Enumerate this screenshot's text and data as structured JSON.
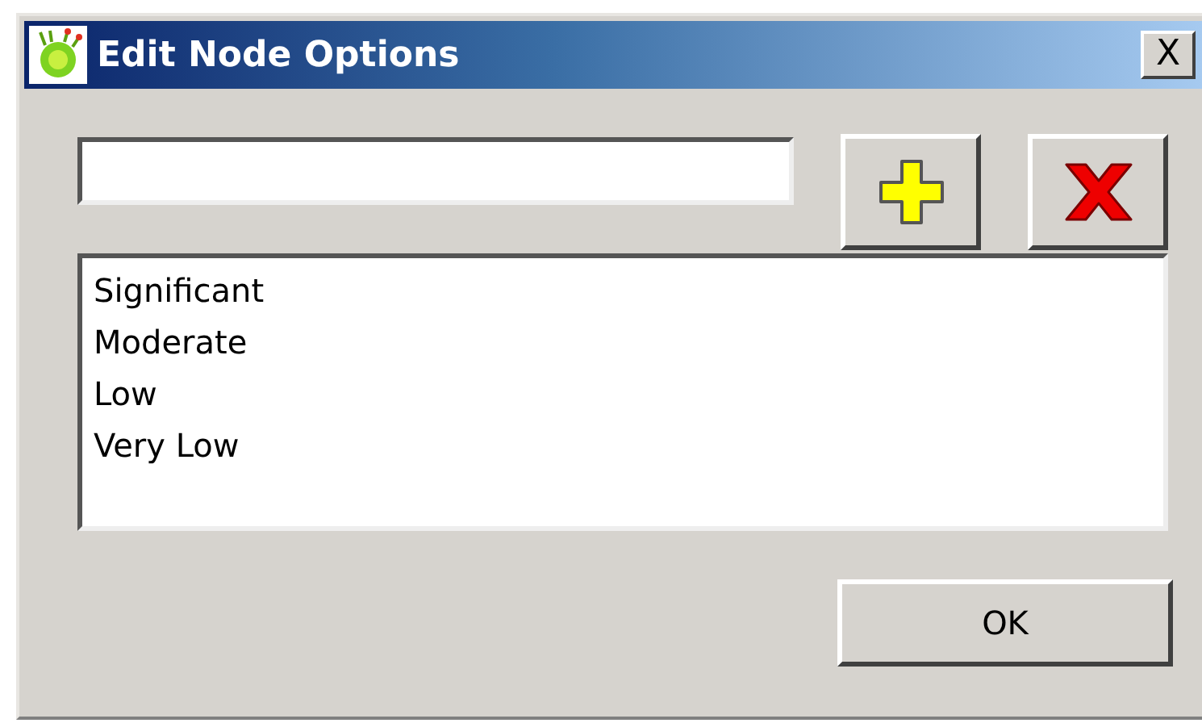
{
  "window": {
    "title": "Edit Node Options",
    "close_label": "X"
  },
  "options": [
    "Significant",
    "Moderate",
    "Low",
    "Very Low"
  ],
  "buttons": [
    {
      "label": "OK"
    }
  ]
}
